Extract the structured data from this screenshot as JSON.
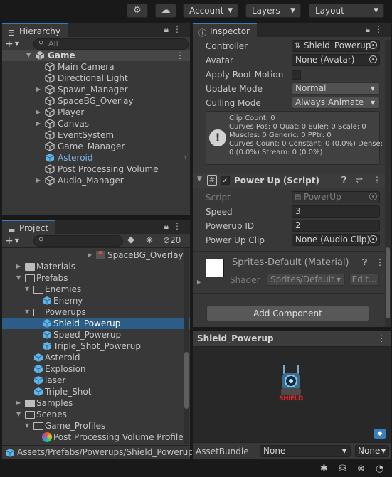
{
  "toolbar": {
    "account_label": "Account",
    "layers_label": "Layers",
    "layout_label": "Layout"
  },
  "hierarchy": {
    "tab_label": "Hierarchy",
    "search_placeholder": "All",
    "scene_name": "Game",
    "items": [
      {
        "label": "Main Camera",
        "expandable": false
      },
      {
        "label": "Directional Light",
        "expandable": false
      },
      {
        "label": "Spawn_Manager",
        "expandable": true
      },
      {
        "label": "SpaceBG_Overlay",
        "expandable": false
      },
      {
        "label": "Player",
        "expandable": true
      },
      {
        "label": "Canvas",
        "expandable": true
      },
      {
        "label": "EventSystem",
        "expandable": false
      },
      {
        "label": "Game_Manager",
        "expandable": false
      },
      {
        "label": "Asteroid",
        "expandable": false,
        "prefab": true
      },
      {
        "label": "Post Processing Volume",
        "expandable": false
      },
      {
        "label": "Audio_Manager",
        "expandable": true
      }
    ]
  },
  "project": {
    "tab_label": "Project",
    "hidden_count": "20",
    "path": "Assets/Prefabs/Powerups/Shield_Powerup.",
    "items": [
      {
        "label": "SpaceBG_Overlay",
        "kind": "asset"
      },
      {
        "label": "Materials",
        "kind": "folder"
      },
      {
        "label": "Prefabs",
        "kind": "folder-open"
      },
      {
        "label": "Enemies",
        "kind": "folder-open"
      },
      {
        "label": "Enemy",
        "kind": "prefab"
      },
      {
        "label": "Powerups",
        "kind": "folder-open"
      },
      {
        "label": "Shield_Powerup",
        "kind": "prefab",
        "selected": true
      },
      {
        "label": "Speed_Powerup",
        "kind": "prefab"
      },
      {
        "label": "Triple_Shot_Powerup",
        "kind": "prefab"
      },
      {
        "label": "Asteroid",
        "kind": "prefab"
      },
      {
        "label": "Explosion",
        "kind": "prefab"
      },
      {
        "label": "laser",
        "kind": "prefab"
      },
      {
        "label": "Triple_Shot",
        "kind": "prefab"
      },
      {
        "label": "Samples",
        "kind": "folder"
      },
      {
        "label": "Scenes",
        "kind": "folder-open"
      },
      {
        "label": "Game_Profiles",
        "kind": "folder-open"
      },
      {
        "label": "Post Processing Volume Profile",
        "kind": "profile"
      }
    ]
  },
  "inspector": {
    "tab_label": "Inspector",
    "animator": {
      "controller_label": "Controller",
      "controller_value": "Shield_Powerup",
      "avatar_label": "Avatar",
      "avatar_value": "None (Avatar)",
      "root_motion_label": "Apply Root Motion",
      "update_mode_label": "Update Mode",
      "update_mode_value": "Normal",
      "culling_mode_label": "Culling Mode",
      "culling_mode_value": "Always Animate",
      "info_lines": [
        "Clip Count: 0",
        "Curves Pos: 0 Quat: 0 Euler: 0 Scale: 0",
        "Muscles: 0 Generic: 0 PPtr: 0",
        "Curves Count: 0 Constant: 0 (0.0%) Dense:",
        "0 (0.0%) Stream: 0 (0.0%)"
      ]
    },
    "script_component": {
      "title": "Power Up (Script)",
      "script_label": "Script",
      "script_value": "PowerUp",
      "speed_label": "Speed",
      "speed_value": "3",
      "powerup_id_label": "Powerup ID",
      "powerup_id_value": "2",
      "clip_label": "Power Up Clip",
      "clip_value": "None (Audio Clip)"
    },
    "material": {
      "title": "Sprites-Default (Material)",
      "shader_label": "Shader",
      "shader_value": "Sprites/Default",
      "edit_label": "Edit..."
    },
    "add_component_label": "Add Component"
  },
  "preview": {
    "title": "Shield_Powerup",
    "asset_bundle_label": "AssetBundle",
    "bundle_value": "None",
    "variant_value": "None",
    "sprite_text": "SHIELD"
  }
}
